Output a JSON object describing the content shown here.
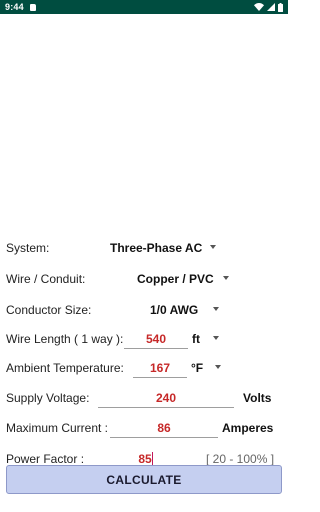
{
  "status_bar": {
    "time": "9:44",
    "icons": [
      "sd-card-icon",
      "wifi-icon",
      "signal-icon",
      "battery-icon"
    ]
  },
  "form": {
    "system": {
      "label": "System:",
      "value": "Three-Phase AC"
    },
    "wire_conduit": {
      "label": "Wire / Conduit:",
      "value": "Copper / PVC"
    },
    "conductor_size": {
      "label": "Conductor Size:",
      "value": "1/0 AWG"
    },
    "wire_length": {
      "label": "Wire Length ( 1 way ):",
      "value": "540",
      "unit": "ft"
    },
    "ambient_temperature": {
      "label": "Ambient Temperature:",
      "value": "167",
      "unit": "°F"
    },
    "supply_voltage": {
      "label": "Supply Voltage:",
      "value": "240",
      "unit": "Volts"
    },
    "maximum_current": {
      "label": "Maximum Current :",
      "value": "86",
      "unit": "Amperes"
    },
    "power_factor": {
      "label": "Power Factor :",
      "value": "85",
      "range": "[ 20 - 100% ]"
    }
  },
  "calculate_button": {
    "label": "CALCULATE"
  },
  "colors": {
    "status_bar": "#004d40",
    "value_text": "#c62828",
    "active_underline": "#c2185b",
    "button_bg": "#c5cff0"
  }
}
